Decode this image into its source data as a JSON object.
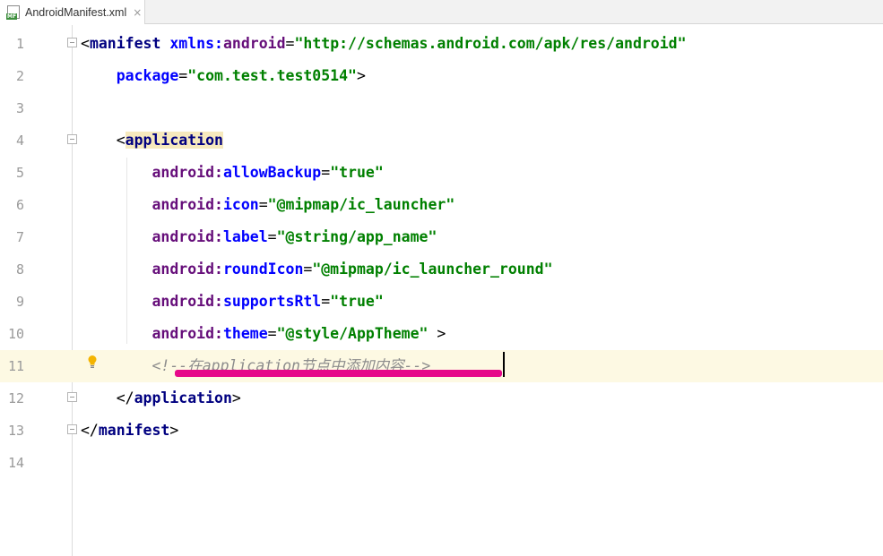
{
  "tab": {
    "filename": "AndroidManifest.xml",
    "icon_badge": "MF",
    "close_glyph": "×"
  },
  "editor": {
    "line_numbers": [
      "1",
      "2",
      "3",
      "4",
      "5",
      "6",
      "7",
      "8",
      "9",
      "10",
      "11",
      "12",
      "13",
      "14"
    ],
    "lines": [
      [
        {
          "t": "<",
          "c": "bracket"
        },
        {
          "t": "manifest",
          "c": "tag"
        },
        {
          "t": " ",
          "c": "bracket"
        },
        {
          "t": "xmlns:",
          "c": "attr"
        },
        {
          "t": "android",
          "c": "attr2"
        },
        {
          "t": "=",
          "c": "bracket"
        },
        {
          "t": "\"http://schemas.android.com/apk/res/android\"",
          "c": "val"
        }
      ],
      [
        {
          "t": "    ",
          "c": "bracket"
        },
        {
          "t": "package",
          "c": "attr"
        },
        {
          "t": "=",
          "c": "bracket"
        },
        {
          "t": "\"com.test.test0514\"",
          "c": "val"
        },
        {
          "t": ">",
          "c": "bracket"
        }
      ],
      [],
      [
        {
          "t": "    <",
          "c": "bracket"
        },
        {
          "t": "application",
          "c": "tag-hl"
        }
      ],
      [
        {
          "t": "        ",
          "c": "bracket"
        },
        {
          "t": "android:",
          "c": "ns"
        },
        {
          "t": "allowBackup",
          "c": "attr"
        },
        {
          "t": "=",
          "c": "bracket"
        },
        {
          "t": "\"true\"",
          "c": "val"
        }
      ],
      [
        {
          "t": "        ",
          "c": "bracket"
        },
        {
          "t": "android:",
          "c": "ns"
        },
        {
          "t": "icon",
          "c": "attr"
        },
        {
          "t": "=",
          "c": "bracket"
        },
        {
          "t": "\"@mipmap/ic_launcher\"",
          "c": "val"
        }
      ],
      [
        {
          "t": "        ",
          "c": "bracket"
        },
        {
          "t": "android:",
          "c": "ns"
        },
        {
          "t": "label",
          "c": "attr"
        },
        {
          "t": "=",
          "c": "bracket"
        },
        {
          "t": "\"@string/app_name\"",
          "c": "val"
        }
      ],
      [
        {
          "t": "        ",
          "c": "bracket"
        },
        {
          "t": "android:",
          "c": "ns"
        },
        {
          "t": "roundIcon",
          "c": "attr"
        },
        {
          "t": "=",
          "c": "bracket"
        },
        {
          "t": "\"@mipmap/ic_launcher_round\"",
          "c": "val"
        }
      ],
      [
        {
          "t": "        ",
          "c": "bracket"
        },
        {
          "t": "android:",
          "c": "ns"
        },
        {
          "t": "supportsRtl",
          "c": "attr"
        },
        {
          "t": "=",
          "c": "bracket"
        },
        {
          "t": "\"true\"",
          "c": "val"
        }
      ],
      [
        {
          "t": "        ",
          "c": "bracket"
        },
        {
          "t": "android:",
          "c": "ns"
        },
        {
          "t": "theme",
          "c": "attr"
        },
        {
          "t": "=",
          "c": "bracket"
        },
        {
          "t": "\"@style/AppTheme\"",
          "c": "val"
        },
        {
          "t": " >",
          "c": "bracket"
        }
      ],
      [
        {
          "t": "        ",
          "c": "bracket"
        },
        {
          "t": "<!--在application节点中添加内容-->",
          "c": "comment"
        }
      ],
      [
        {
          "t": "    </",
          "c": "bracket"
        },
        {
          "t": "application",
          "c": "tag"
        },
        {
          "t": ">",
          "c": "bracket"
        }
      ],
      [
        {
          "t": "</",
          "c": "bracket"
        },
        {
          "t": "manifest",
          "c": "tag"
        },
        {
          "t": ">",
          "c": "bracket"
        }
      ],
      []
    ],
    "current_line": "11",
    "colors": {
      "tag": "#000080",
      "attribute": "#0000ff",
      "namespace": "#660e7a",
      "value": "#008000",
      "comment": "#8c8c8c",
      "current_line_bg": "#fdf9e3",
      "annotation_underline": "#e6088a"
    },
    "icons": [
      "xml-file-icon",
      "close-icon",
      "fold-icon",
      "intention-bulb-icon"
    ]
  }
}
